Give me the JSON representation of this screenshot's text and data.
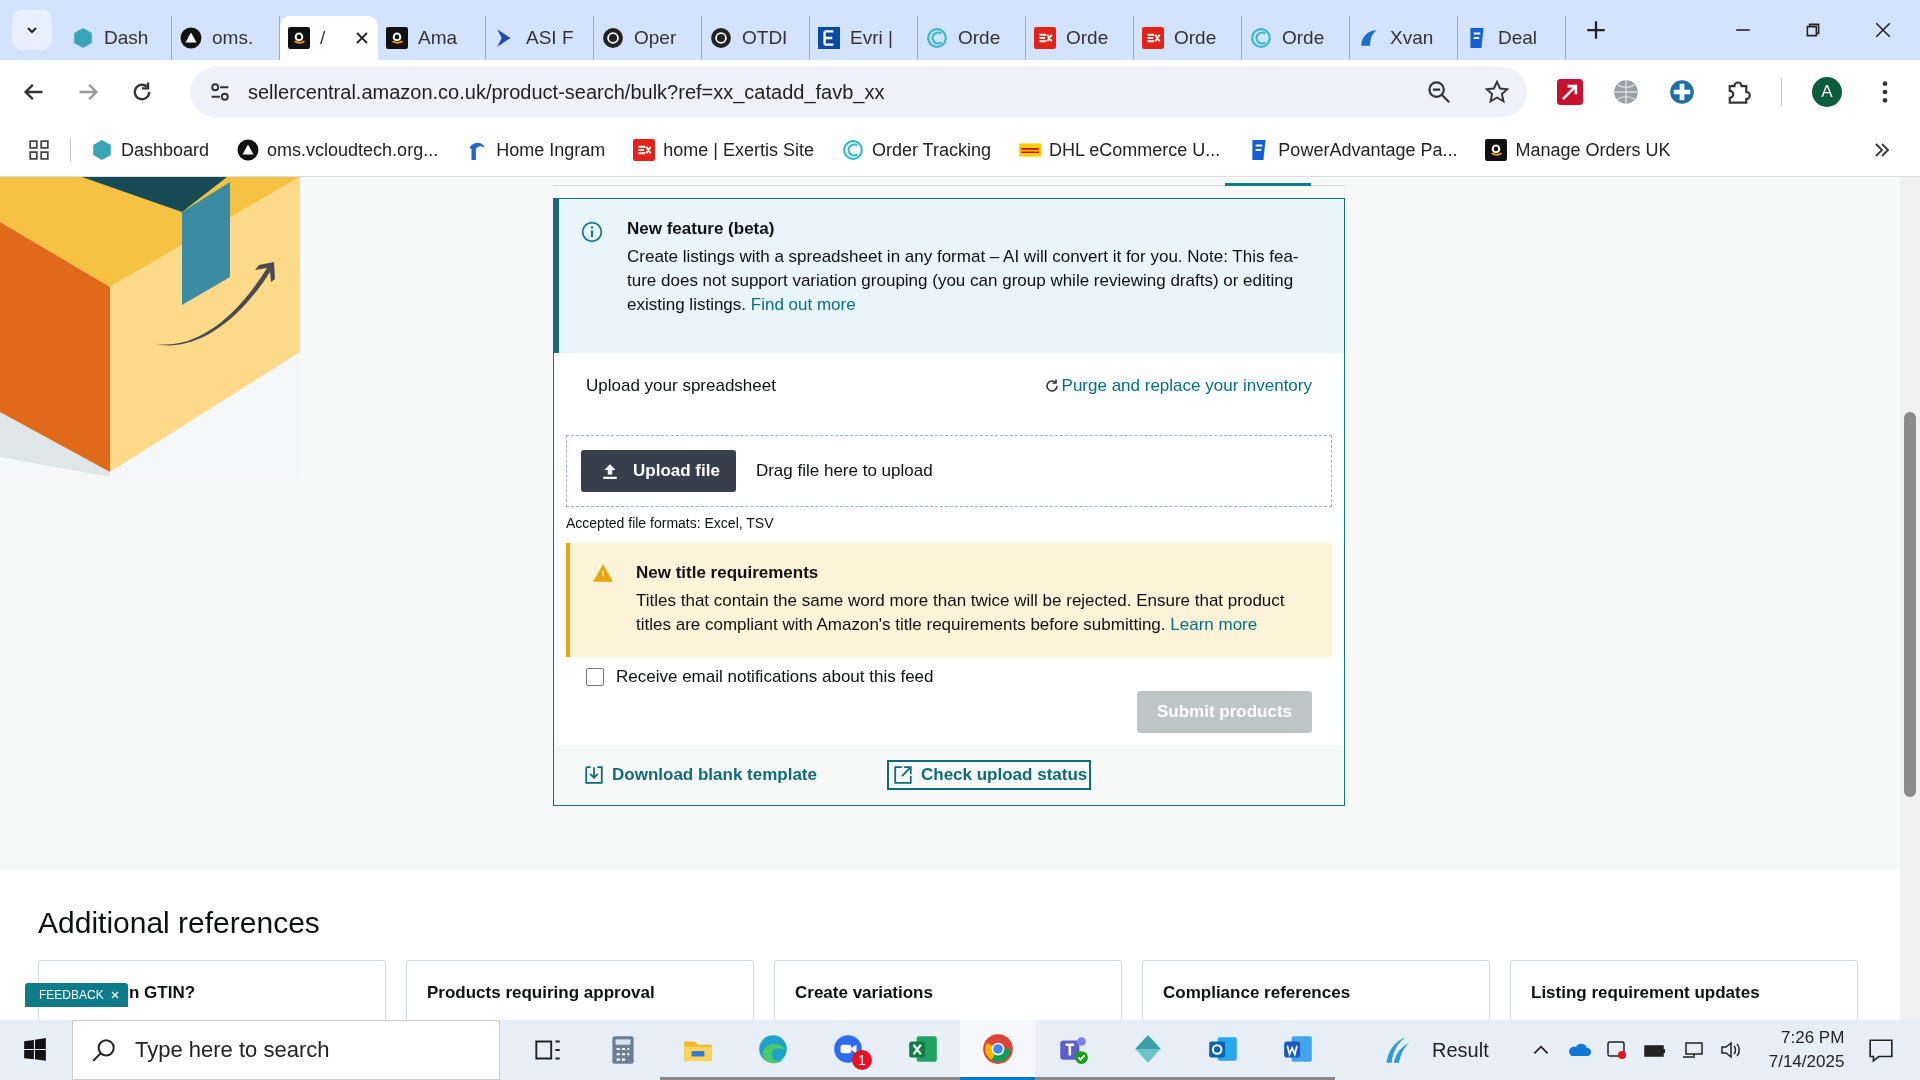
{
  "browser": {
    "tabs": [
      {
        "label": "Dash",
        "selected": false
      },
      {
        "label": "oms.",
        "selected": false
      },
      {
        "label": "/",
        "selected": true
      },
      {
        "label": "Ama",
        "selected": false
      },
      {
        "label": "ASI F",
        "selected": false
      },
      {
        "label": "Oper",
        "selected": false
      },
      {
        "label": "OTDI",
        "selected": false
      },
      {
        "label": "Evri |",
        "selected": false
      },
      {
        "label": "Orde",
        "selected": false
      },
      {
        "label": "Orde",
        "selected": false
      },
      {
        "label": "Orde",
        "selected": false
      },
      {
        "label": "Orde",
        "selected": false
      },
      {
        "label": "Xvan",
        "selected": false
      },
      {
        "label": "Deal",
        "selected": false
      }
    ],
    "address": "sellercentral.amazon.co.uk/product-search/bulk?ref=xx_catadd_favb_xx",
    "avatar": "A",
    "bookmarks": [
      "Dashboard",
      "oms.vcloudtech.org...",
      "Home Ingram",
      "home | Exertis Site",
      "Order Tracking",
      "DHL eCommerce U...",
      "PowerAdvantage Pa...",
      "Manage Orders UK"
    ]
  },
  "info": {
    "title": "New feature (beta)",
    "text": "Create listings with a spreadsheet in any format – AI will convert it for you. Note: This fea- ture does not support variation grouping (you can group while reviewing drafts) or editing existing listings.",
    "link": "Find out more"
  },
  "upload": {
    "heading": "Upload your spreadsheet",
    "purge_link": "Purge and replace your inventory",
    "button": "Upload file",
    "drop_hint": "Drag file here to upload",
    "formats": "Accepted file formats: Excel, TSV"
  },
  "warning": {
    "title": "New title requirements",
    "text": "Titles that contain the same word more than twice will be rejected. Ensure that product titles are compliant with Amazon's title requirements before submitting.",
    "link": "Learn more"
  },
  "notify": {
    "label": "Receive email notifications about this feed",
    "checked": false
  },
  "submit": {
    "label": "Submit products",
    "disabled": true
  },
  "footer_links": [
    "Download blank template",
    "Check upload status"
  ],
  "references": {
    "heading": "Additional references",
    "cards": [
      "n GTIN?",
      "Products requiring approval",
      "Create variations",
      "Compliance references",
      "Listing requirement updates"
    ]
  },
  "feedback": "FEEDBACK",
  "taskbar": {
    "search_placeholder": "Type here to search",
    "badge": "1",
    "weather": "Result",
    "time": "7:26 PM",
    "date": "7/14/2025"
  }
}
